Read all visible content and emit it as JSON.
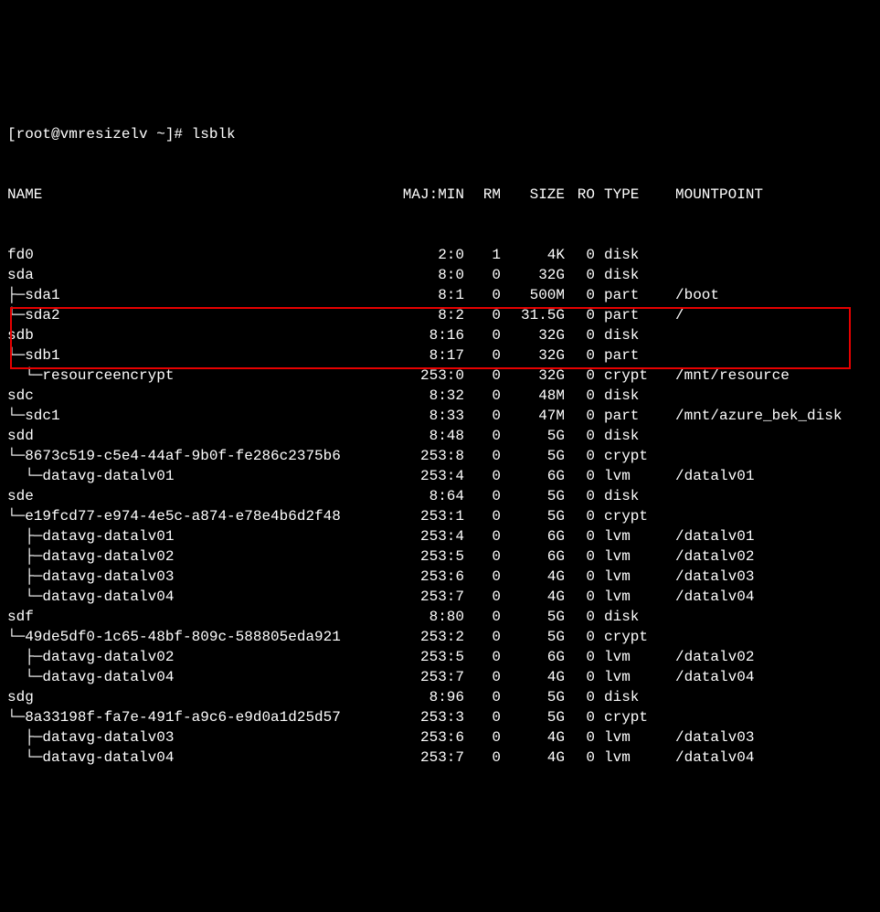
{
  "prompt": "[root@vmresizelv ~]# lsblk",
  "header": {
    "name": "NAME",
    "majmin": "MAJ:MIN",
    "rm": "RM",
    "size": "SIZE",
    "ro": "RO",
    "type": "TYPE",
    "mount": "MOUNTPOINT"
  },
  "rows": [
    {
      "name": "fd0",
      "majmin": "2:0",
      "rm": "1",
      "size": "4K",
      "ro": "0",
      "type": "disk",
      "mount": ""
    },
    {
      "name": "sda",
      "majmin": "8:0",
      "rm": "0",
      "size": "32G",
      "ro": "0",
      "type": "disk",
      "mount": ""
    },
    {
      "name": "├─sda1",
      "majmin": "8:1",
      "rm": "0",
      "size": "500M",
      "ro": "0",
      "type": "part",
      "mount": "/boot"
    },
    {
      "name": "└─sda2",
      "majmin": "8:2",
      "rm": "0",
      "size": "31.5G",
      "ro": "0",
      "type": "part",
      "mount": "/"
    },
    {
      "name": "sdb",
      "majmin": "8:16",
      "rm": "0",
      "size": "32G",
      "ro": "0",
      "type": "disk",
      "mount": ""
    },
    {
      "name": "└─sdb1",
      "majmin": "8:17",
      "rm": "0",
      "size": "32G",
      "ro": "0",
      "type": "part",
      "mount": ""
    },
    {
      "name": "  └─resourceencrypt",
      "majmin": "253:0",
      "rm": "0",
      "size": "32G",
      "ro": "0",
      "type": "crypt",
      "mount": "/mnt/resource"
    },
    {
      "name": "sdc",
      "majmin": "8:32",
      "rm": "0",
      "size": "48M",
      "ro": "0",
      "type": "disk",
      "mount": ""
    },
    {
      "name": "└─sdc1",
      "majmin": "8:33",
      "rm": "0",
      "size": "47M",
      "ro": "0",
      "type": "part",
      "mount": "/mnt/azure_bek_disk"
    },
    {
      "name": "sdd",
      "majmin": "8:48",
      "rm": "0",
      "size": "5G",
      "ro": "0",
      "type": "disk",
      "mount": ""
    },
    {
      "name": "└─8673c519-c5e4-44af-9b0f-fe286c2375b6",
      "majmin": "253:8",
      "rm": "0",
      "size": "5G",
      "ro": "0",
      "type": "crypt",
      "mount": ""
    },
    {
      "name": "  └─datavg-datalv01",
      "majmin": "253:4",
      "rm": "0",
      "size": "6G",
      "ro": "0",
      "type": "lvm",
      "mount": "/datalv01"
    },
    {
      "name": "sde",
      "majmin": "8:64",
      "rm": "0",
      "size": "5G",
      "ro": "0",
      "type": "disk",
      "mount": ""
    },
    {
      "name": "└─e19fcd77-e974-4e5c-a874-e78e4b6d2f48",
      "majmin": "253:1",
      "rm": "0",
      "size": "5G",
      "ro": "0",
      "type": "crypt",
      "mount": ""
    },
    {
      "name": "  ├─datavg-datalv01",
      "majmin": "253:4",
      "rm": "0",
      "size": "6G",
      "ro": "0",
      "type": "lvm",
      "mount": "/datalv01"
    },
    {
      "name": "  ├─datavg-datalv02",
      "majmin": "253:5",
      "rm": "0",
      "size": "6G",
      "ro": "0",
      "type": "lvm",
      "mount": "/datalv02"
    },
    {
      "name": "  ├─datavg-datalv03",
      "majmin": "253:6",
      "rm": "0",
      "size": "4G",
      "ro": "0",
      "type": "lvm",
      "mount": "/datalv03"
    },
    {
      "name": "  └─datavg-datalv04",
      "majmin": "253:7",
      "rm": "0",
      "size": "4G",
      "ro": "0",
      "type": "lvm",
      "mount": "/datalv04"
    },
    {
      "name": "sdf",
      "majmin": "8:80",
      "rm": "0",
      "size": "5G",
      "ro": "0",
      "type": "disk",
      "mount": ""
    },
    {
      "name": "└─49de5df0-1c65-48bf-809c-588805eda921",
      "majmin": "253:2",
      "rm": "0",
      "size": "5G",
      "ro": "0",
      "type": "crypt",
      "mount": ""
    },
    {
      "name": "  ├─datavg-datalv02",
      "majmin": "253:5",
      "rm": "0",
      "size": "6G",
      "ro": "0",
      "type": "lvm",
      "mount": "/datalv02"
    },
    {
      "name": "  └─datavg-datalv04",
      "majmin": "253:7",
      "rm": "0",
      "size": "4G",
      "ro": "0",
      "type": "lvm",
      "mount": "/datalv04"
    },
    {
      "name": "sdg",
      "majmin": "8:96",
      "rm": "0",
      "size": "5G",
      "ro": "0",
      "type": "disk",
      "mount": ""
    },
    {
      "name": "└─8a33198f-fa7e-491f-a9c6-e9d0a1d25d57",
      "majmin": "253:3",
      "rm": "0",
      "size": "5G",
      "ro": "0",
      "type": "crypt",
      "mount": ""
    },
    {
      "name": "  ├─datavg-datalv03",
      "majmin": "253:6",
      "rm": "0",
      "size": "4G",
      "ro": "0",
      "type": "lvm",
      "mount": "/datalv03"
    },
    {
      "name": "  └─datavg-datalv04",
      "majmin": "253:7",
      "rm": "0",
      "size": "4G",
      "ro": "0",
      "type": "lvm",
      "mount": "/datalv04"
    }
  ],
  "highlight": {
    "startRow": 9,
    "endRow": 11
  }
}
